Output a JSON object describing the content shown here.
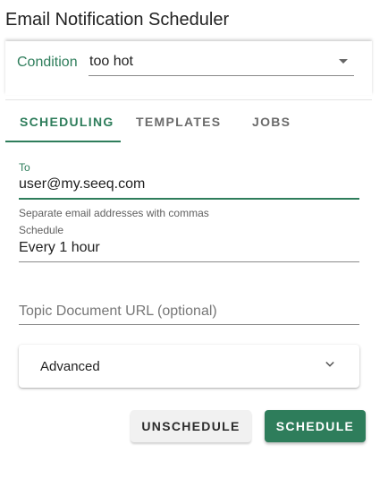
{
  "app": {
    "title": "Email Notification Scheduler"
  },
  "condition": {
    "label": "Condition",
    "selected": "too hot"
  },
  "tabs": [
    {
      "label": "Scheduling",
      "active": true
    },
    {
      "label": "Templates",
      "active": false
    },
    {
      "label": "Jobs",
      "active": false
    }
  ],
  "form": {
    "to": {
      "label": "To",
      "value": "user@my.seeq.com",
      "helper": "Separate email addresses with commas"
    },
    "schedule": {
      "label": "Schedule",
      "value": "Every 1 hour"
    },
    "topic_url": {
      "placeholder": "Topic Document URL (optional)",
      "value": ""
    },
    "advanced": {
      "label": "Advanced",
      "expanded": false
    }
  },
  "actions": {
    "unschedule_label": "Unschedule",
    "schedule_label": "Schedule"
  },
  "colors": {
    "accent": "#2e7d5b",
    "button_secondary_bg": "#f1f1f1"
  }
}
